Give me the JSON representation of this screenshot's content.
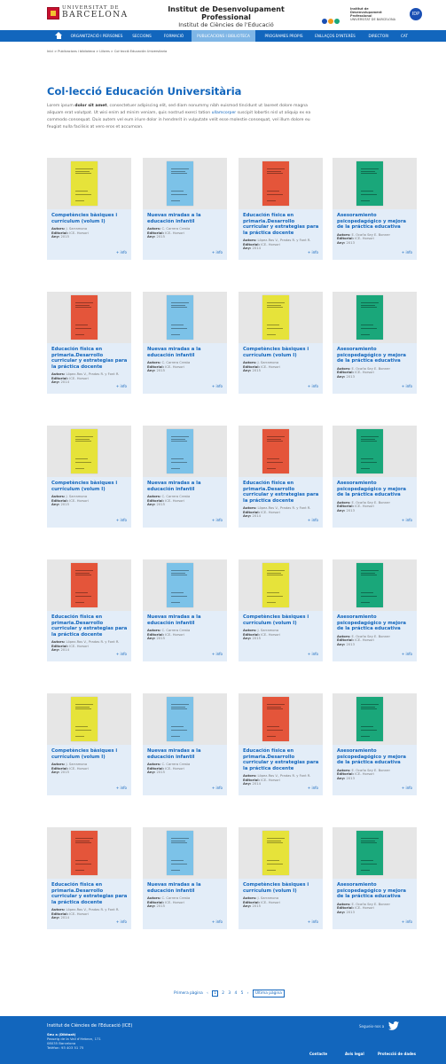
{
  "header": {
    "ub_line1": "UNIVERSITAT DE",
    "ub_line2": "BARCELONA",
    "institute_title": "Institut de Desenvolupament Professional",
    "institute_subtitle": "Institut de Ciències de l'Educació",
    "idp_line1": "Institut de Desenvolupament",
    "idp_line2": "Professional",
    "idp_line3": "UNIVERSITAT DE BARCELONA",
    "avatar_text": "IDP"
  },
  "nav": {
    "items": [
      "Organització i persones",
      "Seccions",
      "Formació",
      "Publicacions i biblioteca",
      "Programes propis",
      "Enllaços d'interès",
      "Directori",
      "Cat"
    ]
  },
  "breadcrumb": "Inici > Publicacions i biblioteca > Llibres > Col·lecció Educación Universitaria",
  "page": {
    "title": "Col·lecció Educación Universitària",
    "intro_pre": "Lorem ipsum ",
    "intro_bold": "dolor sit amet",
    "intro_mid": ", consectetuer adipiscing elit, sed diam nonummy nibh euismod tincidunt ut laoreet dolore magna aliquam erat volutpat. Ut wisi enim ad minim veniam, quis nostrud exerci tation ",
    "intro_link": "ullamcorper",
    "intro_post": " suscipit lobortis nisl ut aliquip ex ea commodo consequat. Duis autem vel eum iriure dolor in hendrerit in vulputate velit esse molestie consequat, vel illum dolore eu feugiat nulla facilisis at vero eros et accumsan."
  },
  "labels": {
    "author": "Autors:",
    "publisher": "Editorial:",
    "year": "Any:",
    "more": "+ info"
  },
  "cards": [
    {
      "title": "Competències bàsiques i currículum (volum I)",
      "author": "J. Sarramona",
      "publisher": "ICE- Horsori",
      "year": "2015",
      "color": "#e6e33a"
    },
    {
      "title": "Nuevas miradas a la educación infantil",
      "author": "C. Carrera Cresta",
      "publisher": "ICE- Horsori",
      "year": "2015",
      "color": "#7cc2e8"
    },
    {
      "title": "Educación física en primaria.Desarrollo curricular y estrategias para la práctica docente",
      "author": "López-Ros V., Pradas R. y Font R.",
      "publisher": "ICE- Horsori",
      "year": "2014",
      "color": "#e4553a"
    },
    {
      "title": "Asesoramiento psicopedagógico y mejora de la práctica educativa",
      "author": "E. Ocaña Sey E. Bonner",
      "publisher": "ICE- Horsori",
      "year": "2013",
      "color": "#1aa77a"
    },
    {
      "title": "Educación física en primaria.Desarrollo curricular y estrategias para la práctica docente",
      "author": "López-Ros V., Pradas R. y Font R.",
      "publisher": "ICE- Horsori",
      "year": "2014",
      "color": "#e4553a"
    },
    {
      "title": "Nuevas miradas a la educación infantil",
      "author": "C. Carrera Cresta",
      "publisher": "ICE- Horsori",
      "year": "2015",
      "color": "#7cc2e8"
    },
    {
      "title": "Competències bàsiques i currículum (volum I)",
      "author": "J. Sarramona",
      "publisher": "ICE- Horsori",
      "year": "2015",
      "color": "#e6e33a"
    },
    {
      "title": "Asesoramiento psicopedagógico y mejora de la práctica educativa",
      "author": "E. Ocaña Sey E. Bonner",
      "publisher": "ICE- Horsori",
      "year": "2013",
      "color": "#1aa77a"
    },
    {
      "title": "Competències bàsiques i currículum (volum I)",
      "author": "J. Sarramona",
      "publisher": "ICE- Horsori",
      "year": "2015",
      "color": "#e6e33a"
    },
    {
      "title": "Nuevas miradas a la educación infantil",
      "author": "C. Carrera Cresta",
      "publisher": "ICE- Horsori",
      "year": "2015",
      "color": "#7cc2e8"
    },
    {
      "title": "Educación física en primaria.Desarrollo curricular y estrategias para la práctica docente",
      "author": "López-Ros V., Pradas R. y Font R.",
      "publisher": "ICE- Horsori",
      "year": "2014",
      "color": "#e4553a"
    },
    {
      "title": "Asesoramiento psicopedagógico y mejora de la práctica educativa",
      "author": "E. Ocaña Sey E. Bonner",
      "publisher": "ICE- Horsori",
      "year": "2013",
      "color": "#1aa77a"
    },
    {
      "title": "Educación física en primaria.Desarrollo curricular y estrategias para la práctica docente",
      "author": "López-Ros V., Pradas R. y Font R.",
      "publisher": "ICE- Horsori",
      "year": "2014",
      "color": "#e4553a"
    },
    {
      "title": "Nuevas miradas a la educación infantil",
      "author": "C. Carrera Cresta",
      "publisher": "ICE- Horsori",
      "year": "2015",
      "color": "#7cc2e8"
    },
    {
      "title": "Competències bàsiques i currículum (volum I)",
      "author": "J. Sarramona",
      "publisher": "ICE- Horsori",
      "year": "2015",
      "color": "#e6e33a"
    },
    {
      "title": "Asesoramiento psicopedagógico y mejora de la práctica educativa",
      "author": "E. Ocaña Sey E. Bonner",
      "publisher": "ICE- Horsori",
      "year": "2013",
      "color": "#1aa77a"
    },
    {
      "title": "Competències bàsiques i currículum (volum I)",
      "author": "J. Sarramona",
      "publisher": "ICE- Horsori",
      "year": "2015",
      "color": "#e6e33a"
    },
    {
      "title": "Nuevas miradas a la educación infantil",
      "author": "C. Carrera Cresta",
      "publisher": "ICE- Horsori",
      "year": "2015",
      "color": "#7cc2e8"
    },
    {
      "title": "Educación física en primaria.Desarrollo curricular y estrategias para la práctica docente",
      "author": "López-Ros V., Pradas R. y Font R.",
      "publisher": "ICE- Horsori",
      "year": "2014",
      "color": "#e4553a"
    },
    {
      "title": "Asesoramiento psicopedagógico y mejora de la práctica educativa",
      "author": "E. Ocaña Sey E. Bonner",
      "publisher": "ICE- Horsori",
      "year": "2013",
      "color": "#1aa77a"
    },
    {
      "title": "Educación física en primaria.Desarrollo curricular y estrategias para la práctica docente",
      "author": "López-Ros V., Pradas R. y Font R.",
      "publisher": "ICE- Horsori",
      "year": "2014",
      "color": "#e4553a"
    },
    {
      "title": "Nuevas miradas a la educación infantil",
      "author": "C. Carrera Cresta",
      "publisher": "ICE- Horsori",
      "year": "2015",
      "color": "#7cc2e8"
    },
    {
      "title": "Competències bàsiques i currículum (volum I)",
      "author": "J. Sarramona",
      "publisher": "ICE- Horsori",
      "year": "2015",
      "color": "#e6e33a"
    },
    {
      "title": "Asesoramiento psicopedagógico y mejora de la práctica educativa",
      "author": "E. Ocaña Sey E. Bonner",
      "publisher": "ICE- Horsori",
      "year": "2013",
      "color": "#1aa77a"
    }
  ],
  "pagination": {
    "first": "Primera pàgina",
    "prev": "‹",
    "pages": [
      "1",
      "2",
      "3",
      "4",
      "5"
    ],
    "current": "1",
    "next": "›",
    "last": "Última pàgina"
  },
  "footer": {
    "name": "Institut de Ciències de l'Educació (ICE)",
    "campus": "Seu a (Diktaat)",
    "address1": "Passeig de la Vall d'Hebron, 171",
    "address2": "08035 Barcelona",
    "phone": "Telèfon: 93 403 51 75",
    "follow": "Segueix-nos a",
    "links": [
      "Contacte",
      "Avís legal",
      "Protecció de dades"
    ]
  }
}
